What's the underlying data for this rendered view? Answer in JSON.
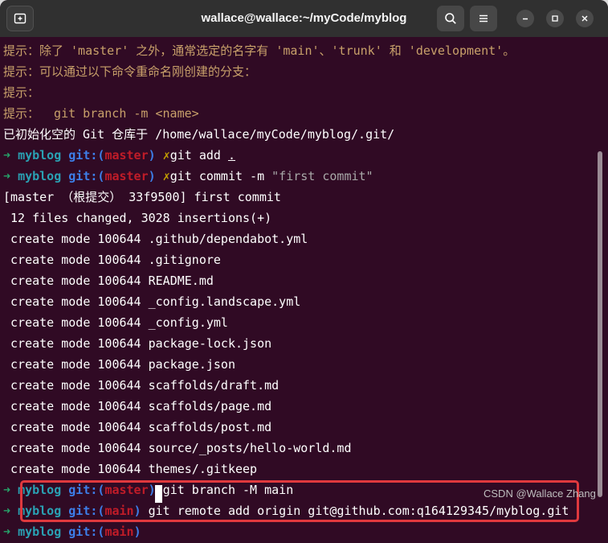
{
  "window": {
    "title": "wallace@wallace:~/myCode/myblog"
  },
  "icons": {
    "new_tab": "new-tab-icon",
    "search": "search-icon",
    "menu": "hamburger-menu-icon",
    "minimize": "minimize-icon",
    "maximize": "maximize-icon",
    "close": "close-icon"
  },
  "colors": {
    "terminal_bg": "#300a24",
    "titlebar_bg": "#303030",
    "hint": "#c8a06a",
    "prompt_arrow": "#26a269",
    "prompt_dir": "#2aa1b3",
    "git_label": "#3d7ee8",
    "branch": "#c01c28",
    "dirty_mark": "#c4a000",
    "highlight_border": "#e0393e"
  },
  "terminal": {
    "hints": [
      "提示：除了 'master' 之外，通常选定的名字有 'main'、'trunk' 和 'development'。",
      "提示：可以通过以下命令重命名刚创建的分支：",
      "提示：",
      "提示：  git branch -m <name>"
    ],
    "init_msg": "已初始化空的 Git 仓库于 /home/wallace/myCode/myblog/.git/",
    "prompts": [
      {
        "arrow": "➜",
        "dir": "myblog",
        "git_open": "git:(",
        "branch": "master",
        "git_close": ")",
        "dirty": "✗",
        "cmd": "git add ",
        "arg": ".",
        "str": ""
      },
      {
        "arrow": "➜",
        "dir": "myblog",
        "git_open": "git:(",
        "branch": "master",
        "git_close": ")",
        "dirty": "✗",
        "cmd": "git commit -m ",
        "arg": "",
        "str": "\"first commit\""
      },
      {
        "arrow": "➜",
        "dir": "myblog",
        "git_open": "git:(",
        "branch": "master",
        "git_close": ")",
        "dirty": "",
        "cmd": "git branch -M main",
        "arg": "",
        "str": ""
      },
      {
        "arrow": "➜",
        "dir": "myblog",
        "git_open": "git:(",
        "branch": "main",
        "git_close": ")",
        "dirty": "",
        "cmd": "git remote add origin git@github.com:q164129345/myblog.git",
        "arg": "",
        "str": ""
      },
      {
        "arrow": "➜",
        "dir": "myblog",
        "git_open": "git:(",
        "branch": "main",
        "git_close": ")",
        "dirty": "",
        "cmd": "",
        "arg": "",
        "str": ""
      }
    ],
    "commit_header": "[master （根提交） 33f9500] first commit",
    "summary": " 12 files changed, 3028 insertions(+)",
    "created_files": [
      " create mode 100644 .github/dependabot.yml",
      " create mode 100644 .gitignore",
      " create mode 100644 README.md",
      " create mode 100644 _config.landscape.yml",
      " create mode 100644 _config.yml",
      " create mode 100644 package-lock.json",
      " create mode 100644 package.json",
      " create mode 100644 scaffolds/draft.md",
      " create mode 100644 scaffolds/page.md",
      " create mode 100644 scaffolds/post.md",
      " create mode 100644 source/_posts/hello-world.md",
      " create mode 100644 themes/.gitkeep"
    ]
  },
  "watermark": "CSDN @Wallace Zhang"
}
